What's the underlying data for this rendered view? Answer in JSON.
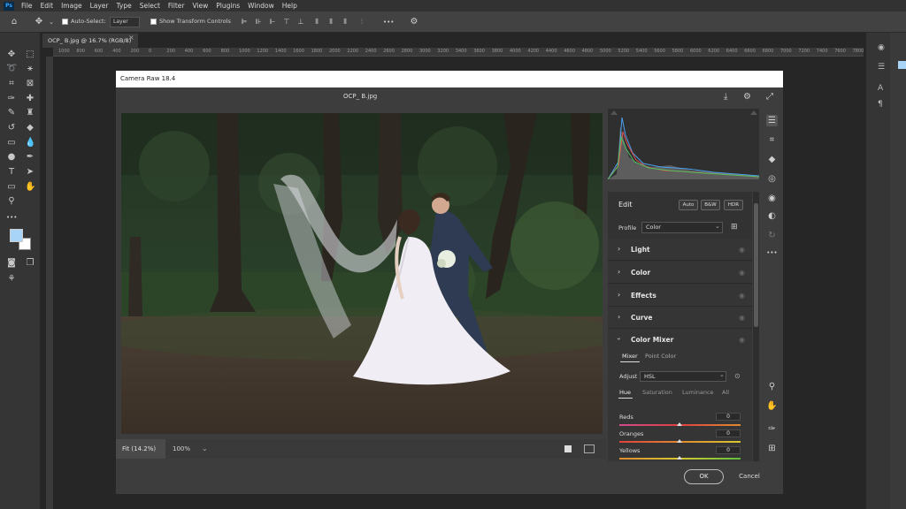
{
  "menubar": {
    "logo": "Ps",
    "items": [
      "File",
      "Edit",
      "Image",
      "Layer",
      "Type",
      "Select",
      "Filter",
      "View",
      "Plugins",
      "Window",
      "Help"
    ]
  },
  "options": {
    "auto_select_label": "Auto-Select:",
    "layer_select": "Layer",
    "show_transform_label": "Show Transform Controls",
    "more": "•••"
  },
  "document": {
    "tab_title": "OCP_ B.jpg @ 16.7% (RGB/8)",
    "ruler_ticks": [
      "1000",
      "800",
      "600",
      "400",
      "200",
      "0",
      "200",
      "400",
      "600",
      "800",
      "1000",
      "1200",
      "1400",
      "1600",
      "1800",
      "2000",
      "2200",
      "2400",
      "2600",
      "2800",
      "3000",
      "3200",
      "3400",
      "3600",
      "3800",
      "4000",
      "4200",
      "4400",
      "4600",
      "4800",
      "5000",
      "5200",
      "5400",
      "5600",
      "5800",
      "6000",
      "6200",
      "6400",
      "6600",
      "6800",
      "7000",
      "7200",
      "7400",
      "7600",
      "7800"
    ]
  },
  "dialog": {
    "title": "Camera Raw 18.4",
    "filename": "OCP_ B.jpg",
    "zoom_fit": "Fit (14.2%)",
    "zoom_100": "100%",
    "ok_label": "OK",
    "cancel_label": "Cancel"
  },
  "edit_panel": {
    "title": "Edit",
    "auto_label": "Auto",
    "bw_label": "B&W",
    "hdr_label": "HDR",
    "profile_label": "Profile",
    "profile_value": "Color",
    "sections": [
      "Light",
      "Color",
      "Effects",
      "Curve"
    ],
    "color_mixer": {
      "title": "Color Mixer",
      "tabs": [
        "Mixer",
        "Point Color"
      ],
      "adjust_label": "Adjust",
      "adjust_value": "HSL",
      "sub_tabs": [
        "Hue",
        "Saturation",
        "Luminance",
        "All"
      ],
      "sliders": [
        {
          "label": "Reds",
          "value": "0"
        },
        {
          "label": "Oranges",
          "value": "0"
        },
        {
          "label": "Yellows",
          "value": "0"
        }
      ]
    }
  },
  "colors": {
    "accent": "#31a8ff",
    "dialog_bg": "#3d3d3d",
    "foreground_swatch": "#a8d4f7",
    "background_swatch": "#ffffff"
  },
  "icons": {
    "tools": [
      "move-icon",
      "marquee-icon",
      "lasso-icon",
      "magic-wand-icon",
      "crop-icon",
      "frame-icon",
      "eyedropper-icon",
      "spot-heal-icon",
      "brush-icon",
      "stamp-icon",
      "history-brush-icon",
      "eraser-icon",
      "gradient-icon",
      "blur-icon",
      "dodge-icon",
      "pen-icon",
      "type-icon",
      "path-select-icon",
      "rectangle-icon",
      "hand-icon",
      "zoom-icon",
      "more-tools-icon"
    ]
  }
}
